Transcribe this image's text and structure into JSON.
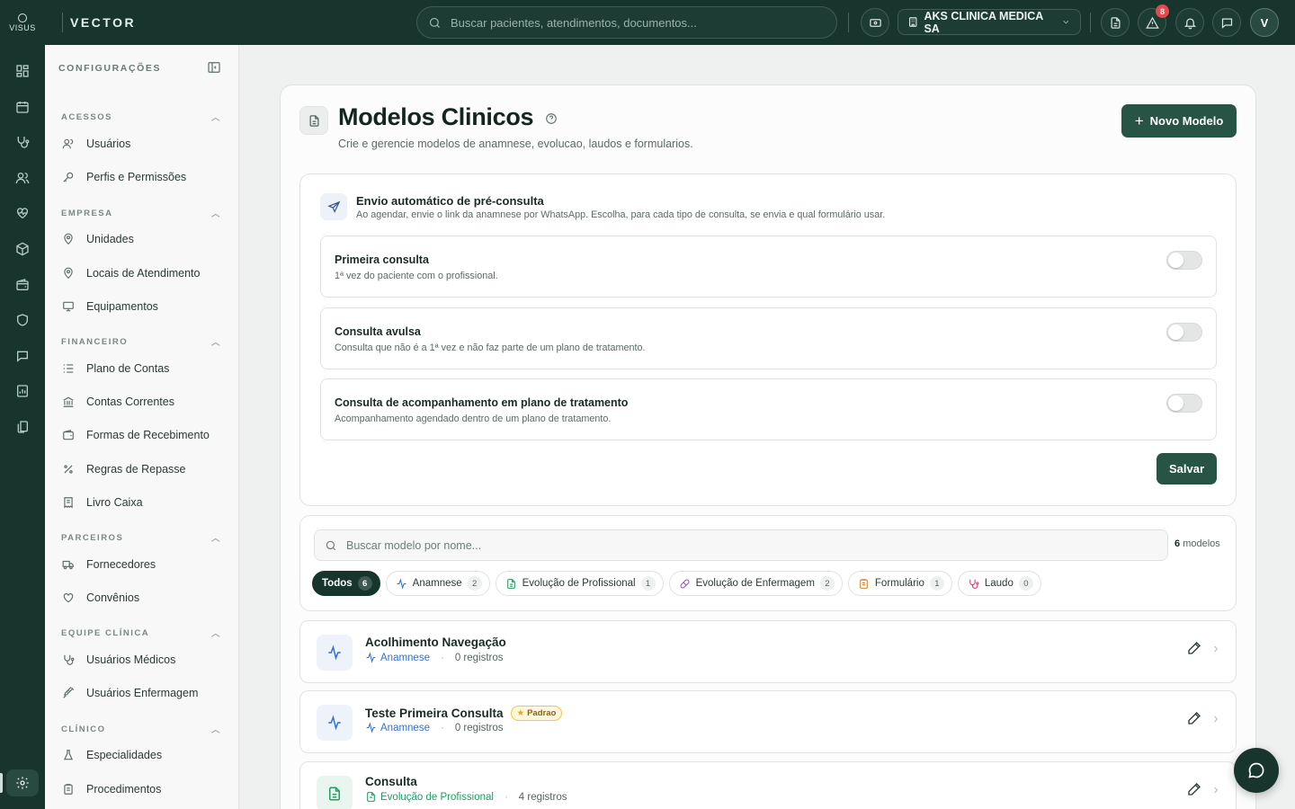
{
  "brand": {
    "logo_text": "VISUS",
    "name": "VECTOR"
  },
  "topbar": {
    "search_placeholder": "Buscar pacientes, atendimentos, documentos...",
    "clinic": "AKS CLINICA MEDICA SA",
    "alerts_badge": "8",
    "avatar": "V"
  },
  "rail": {
    "icons": [
      "dashboard-icon",
      "calendar-icon",
      "stethoscope-icon",
      "users-icon",
      "heart-pulse-icon",
      "package-icon",
      "wallet-icon",
      "shield-icon",
      "chat-icon",
      "report-icon",
      "documents-icon"
    ],
    "active": "settings-icon"
  },
  "sidebar": {
    "title": "CONFIGURAÇÕES",
    "sections": [
      {
        "title": "ACESSOS",
        "items": [
          "Usuários",
          "Perfis e Permissões"
        ]
      },
      {
        "title": "EMPRESA",
        "items": [
          "Unidades",
          "Locais de Atendimento",
          "Equipamentos"
        ]
      },
      {
        "title": "FINANCEIRO",
        "items": [
          "Plano de Contas",
          "Contas Correntes",
          "Formas de Recebimento",
          "Regras de Repasse",
          "Livro Caixa"
        ]
      },
      {
        "title": "PARCEIROS",
        "items": [
          "Fornecedores",
          "Convênios"
        ]
      },
      {
        "title": "EQUIPE CLÍNICA",
        "items": [
          "Usuários Médicos",
          "Usuários Enfermagem"
        ]
      },
      {
        "title": "CLÍNICO",
        "items": [
          "Especialidades",
          "Procedimentos"
        ]
      }
    ]
  },
  "page": {
    "title": "Modelos Clinicos",
    "subtitle": "Crie e gerencie modelos de anamnese, evolucao, laudos e formularios.",
    "new_button": "Novo Modelo"
  },
  "preconsulta": {
    "title": "Envio automático de pré-consulta",
    "subtitle": "Ao agendar, envie o link da anamnese por WhatsApp. Escolha, para cada tipo de consulta, se envia e qual formulário usar.",
    "options": [
      {
        "title": "Primeira consulta",
        "desc": "1ª vez do paciente com o profissional.",
        "enabled": false
      },
      {
        "title": "Consulta avulsa",
        "desc": "Consulta que não é a 1ª vez e não faz parte de um plano de tratamento.",
        "enabled": false
      },
      {
        "title": "Consulta de acompanhamento em plano de tratamento",
        "desc": "Acompanhamento agendado dentro de um plano de tratamento.",
        "enabled": false
      }
    ],
    "save_button": "Salvar"
  },
  "models": {
    "search_placeholder": "Buscar modelo por nome...",
    "count": "6",
    "count_label": "modelos",
    "filters": [
      {
        "label": "Todos",
        "count": "6",
        "active": true,
        "color": ""
      },
      {
        "label": "Anamnese",
        "count": "2",
        "active": false,
        "color": "#2f6fd6"
      },
      {
        "label": "Evolução de Profissional",
        "count": "1",
        "active": false,
        "color": "#1f9d63"
      },
      {
        "label": "Evolução de Enfermagem",
        "count": "2",
        "active": false,
        "color": "#9b4fd6"
      },
      {
        "label": "Formulário",
        "count": "1",
        "active": false,
        "color": "#d9822b"
      },
      {
        "label": "Laudo",
        "count": "0",
        "active": false,
        "color": "#d63d7a"
      }
    ],
    "rows": [
      {
        "title": "Acolhimento Navegação",
        "type": "Anamnese",
        "records": "0 registros",
        "badge": ""
      },
      {
        "title": "Teste Primeira Consulta",
        "type": "Anamnese",
        "records": "0 registros",
        "badge": "Padrao"
      },
      {
        "title": "Consulta",
        "type": "Evolução de Profissional",
        "records": "4 registros",
        "badge": ""
      }
    ]
  },
  "colors": {
    "primary": "#17352d",
    "button": "#285446",
    "anamnese": "#2f6fd6",
    "evolucao": "#1f9d63"
  }
}
